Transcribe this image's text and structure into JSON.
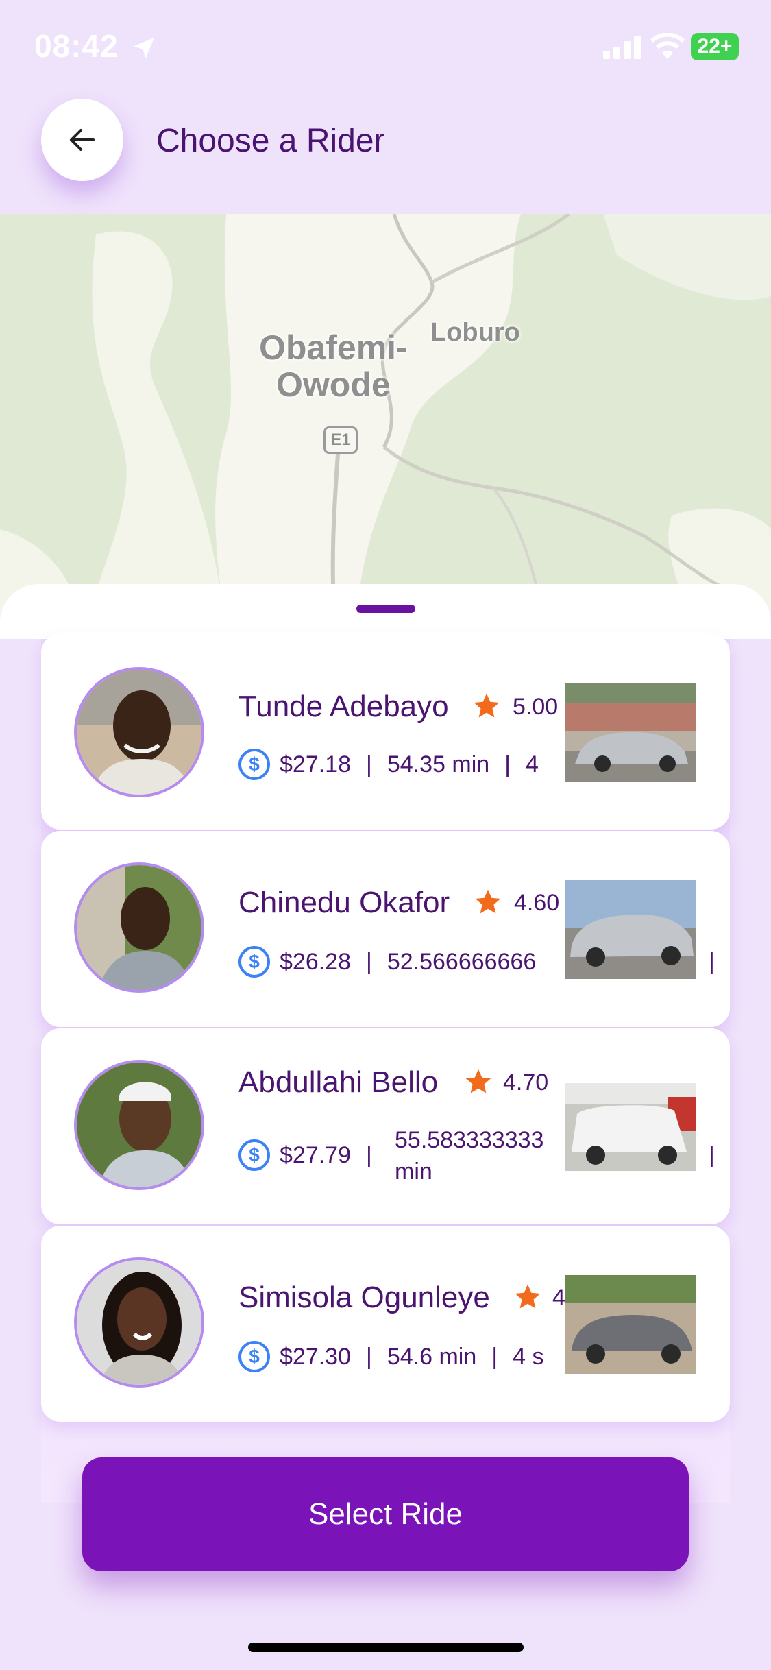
{
  "status_bar": {
    "time": "08:42",
    "battery": "22+",
    "location_icon": "location-arrow-icon",
    "signal_icon": "cellular-signal-icon",
    "wifi_icon": "wifi-icon"
  },
  "header": {
    "back_icon": "arrow-left-icon",
    "title": "Choose a Rider"
  },
  "map": {
    "labels": {
      "city": "Obafemi-\nOwode",
      "town": "Loburo",
      "road": "E1"
    }
  },
  "riders": [
    {
      "name": "Tunde Adebayo",
      "rating": "5.00",
      "price": "$27.18",
      "duration": "54.35 min",
      "extra": "4"
    },
    {
      "name": "Chinedu Okafor",
      "rating": "4.60",
      "price": "$26.28",
      "duration": "52.566666666",
      "extra": ""
    },
    {
      "name": "Abdullahi Bello",
      "rating": "4.70",
      "price": "$27.79",
      "duration": "55.583333333\nmin",
      "extra": ""
    },
    {
      "name": "Simisola Ogunleye",
      "rating": "4",
      "price": "$27.30",
      "duration": "54.6 min",
      "extra": "4 s"
    }
  ],
  "separator": "|",
  "select_button": {
    "label": "Select Ride"
  },
  "colors": {
    "brand_purple": "#7a14b8",
    "title_purple": "#4a1470",
    "star_orange": "#f26a1b",
    "dollar_blue": "#3b82f6",
    "background_lavender": "#efe2fb"
  }
}
